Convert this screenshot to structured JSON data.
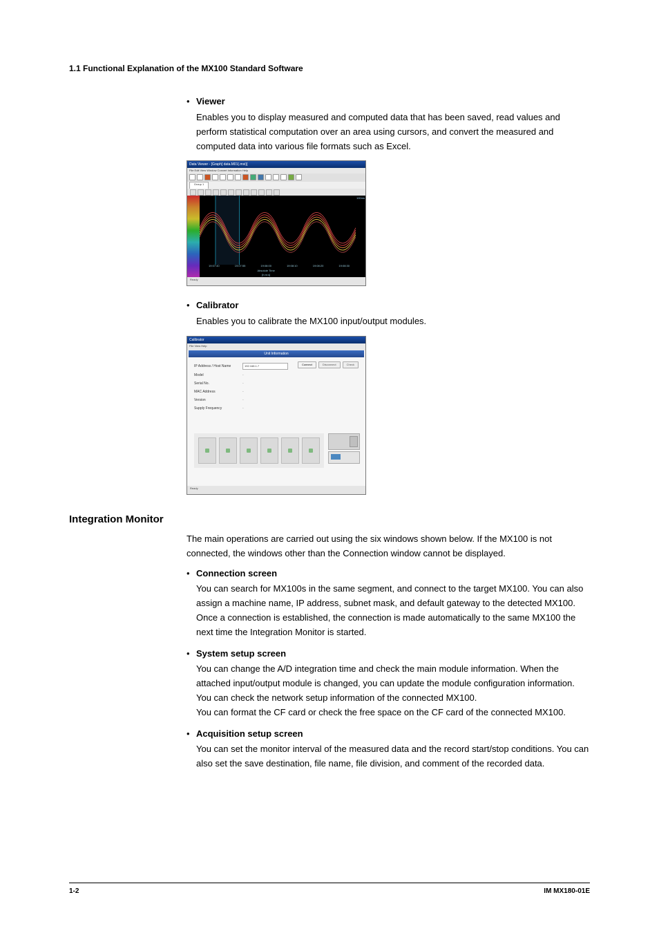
{
  "header": {
    "title": "1.1  Functional Explanation of the MX100 Standard  Software"
  },
  "viewer": {
    "label": "Viewer",
    "desc": "Enables you to display measured and computed data that has been saved, read values and perform statistical computation over an area using cursors, and convert the measured and computed data into various file formats such as Excel.",
    "fig": {
      "title": "Data Viewer - [Graph] data.M01(.mxi)]",
      "menu": "File  Edit  View  Window  Convert  Information  Help",
      "tab": "Group 1",
      "right_label": "100ms",
      "xticks": [
        "19:07:40",
        "19:07:55",
        "19:08:00",
        "19:08:10",
        "19:08:20",
        "19:08:30"
      ],
      "xaxis_caption": "Absolute Time [h:m:s]",
      "status": "Ready"
    }
  },
  "calibrator": {
    "label": "Calibrator",
    "desc": "Enables you to calibrate the MX100 input/output modules.",
    "fig": {
      "title": "Calibrator",
      "menu": "File  View  Help",
      "section": "Unit Information",
      "rows": {
        "ip_label": "IP Address / Host Name",
        "ip_value": "192.168.1.7",
        "model_label": "Model",
        "serial_label": "Serial No.",
        "mac_label": "MAC Address",
        "version_label": "Version",
        "supply_label": "Supply Frequency"
      },
      "buttons": {
        "connect": "Connect",
        "disconnect": "Disconnect",
        "check": "Check"
      },
      "status": "Ready"
    }
  },
  "integration": {
    "heading": "Integration Monitor",
    "intro": "The main operations are carried out using the six windows shown below. If the MX100 is not connected, the windows other than the Connection window cannot be displayed.",
    "conn": {
      "label": "Connection screen",
      "desc": "You can search for MX100s in the same segment, and connect to the target MX100. You can also assign a machine name, IP address, subnet mask, and default gateway to the detected MX100. Once a connection is established, the connection is made automatically to the same MX100 the next time the Integration Monitor is started."
    },
    "system": {
      "label": "System setup screen",
      "p1": "You can change the A/D integration time and check the main module information. When the attached input/output module is changed, you can update the module configuration information.",
      "p2": "You can check the network setup information of the connected MX100.",
      "p3": "You can format the CF card or check the free space on the CF card of the connected MX100."
    },
    "acq": {
      "label": "Acquisition setup screen",
      "desc": "You can set the monitor interval of the measured data and the record start/stop conditions. You can also set the save destination, file name, file division, and comment of the recorded data."
    }
  },
  "footer": {
    "page": "1-2",
    "doc": "IM MX180-01E"
  }
}
